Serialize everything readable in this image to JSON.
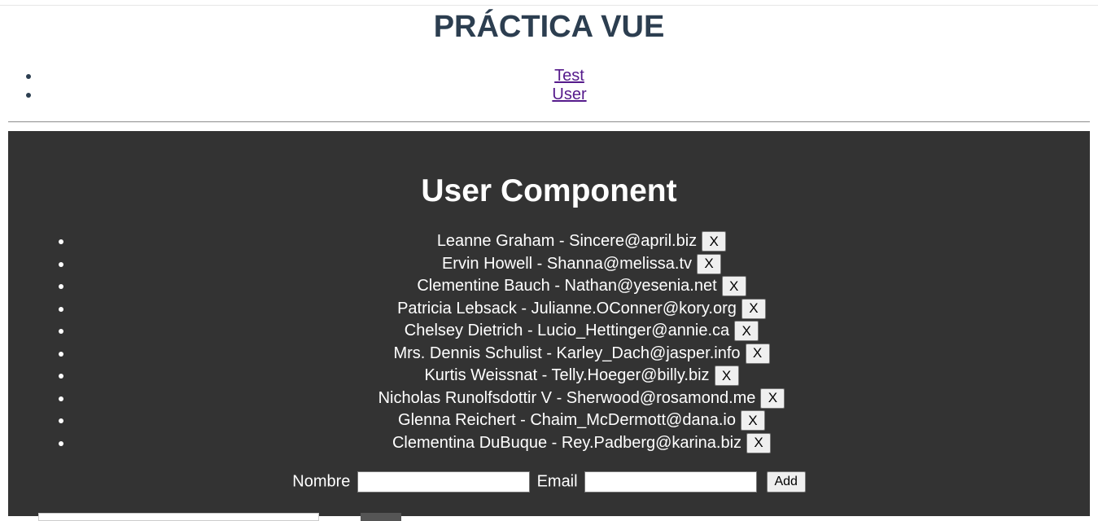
{
  "header": {
    "title": "PRÁCTICA VUE"
  },
  "nav": {
    "items": [
      {
        "label": "Test"
      },
      {
        "label": "User"
      }
    ]
  },
  "user_component": {
    "heading": "User Component",
    "delete_label": "X",
    "users": [
      {
        "text": "Leanne Graham - Sincere@april.biz"
      },
      {
        "text": "Ervin Howell - Shanna@melissa.tv"
      },
      {
        "text": "Clementine Bauch - Nathan@yesenia.net"
      },
      {
        "text": "Patricia Lebsack - Julianne.OConner@kory.org"
      },
      {
        "text": "Chelsey Dietrich - Lucio_Hettinger@annie.ca"
      },
      {
        "text": "Mrs. Dennis Schulist - Karley_Dach@jasper.info"
      },
      {
        "text": "Kurtis Weissnat - Telly.Hoeger@billy.biz"
      },
      {
        "text": "Nicholas Runolfsdottir V - Sherwood@rosamond.me"
      },
      {
        "text": "Glenna Reichert - Chaim_McDermott@dana.io"
      },
      {
        "text": "Clementina DuBuque - Rey.Padberg@karina.biz"
      }
    ],
    "form": {
      "name_label": "Nombre",
      "name_value": "",
      "email_label": "Email",
      "email_value": "",
      "add_label": "Add"
    }
  },
  "colors": {
    "title_text": "#2c3e50",
    "panel_background": "#333333",
    "link": "#551a8b"
  }
}
